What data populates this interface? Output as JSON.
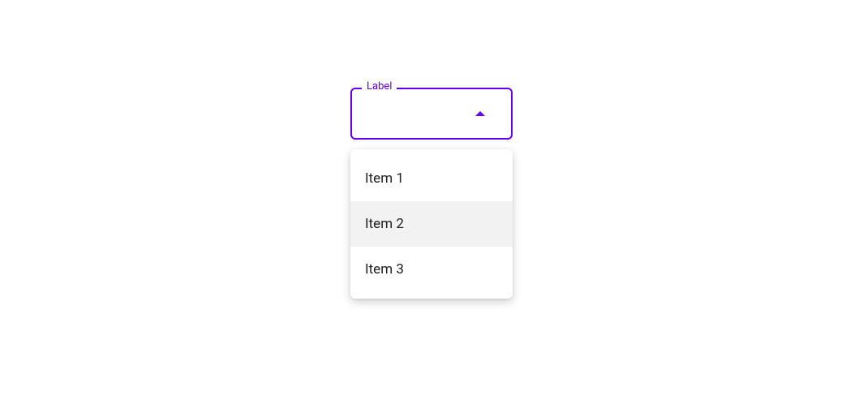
{
  "select": {
    "label": "Label",
    "value": "",
    "open": true
  },
  "menu": {
    "items": [
      {
        "label": "Item 1",
        "hovered": false
      },
      {
        "label": "Item 2",
        "hovered": true
      },
      {
        "label": "Item 3",
        "hovered": false
      }
    ]
  },
  "colors": {
    "primary": "#6200ee"
  }
}
